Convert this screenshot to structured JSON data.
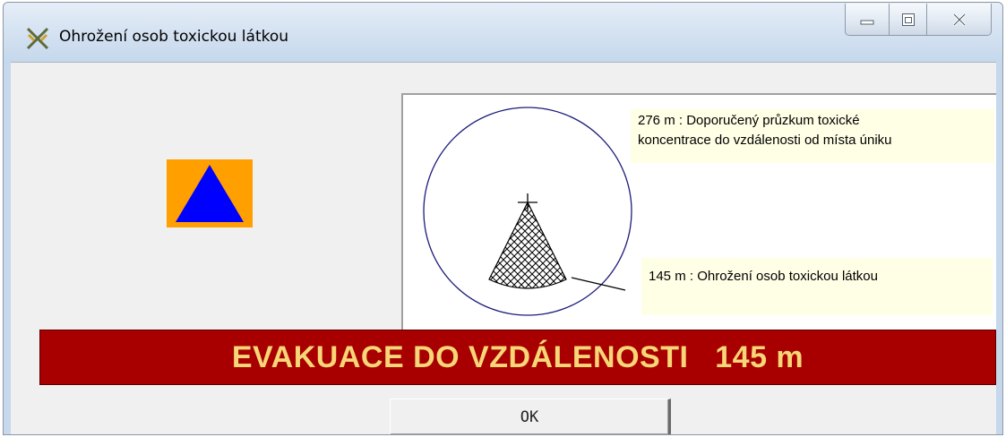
{
  "window": {
    "title": "Ohrožení osob toxickou látkou",
    "icon": "crossed-swords-icon",
    "controls": [
      "minimize-icon",
      "maximize-icon",
      "close-icon"
    ]
  },
  "sign": {
    "icon": "civil-protection-triangle-icon",
    "colors": {
      "background": "#ff9f00",
      "triangle": "#0000ff"
    }
  },
  "diagram": {
    "outer_zone": {
      "distance": "276 m",
      "label_line1": "276 m : Doporučený průzkum toxické",
      "label_line2": "koncentrace do vzdálenosti od místa úniku"
    },
    "danger_zone": {
      "distance": "145 m",
      "label": "145 m : Ohrožení osob toxickou látkou"
    },
    "colors": {
      "circle": "#1c1c7a",
      "note_background": "#ffffe6"
    }
  },
  "banner": {
    "text": "EVAKUACE DO VZDÁLENOSTI   145 m",
    "colors": {
      "background": "#a80000",
      "text": "#f7d677"
    }
  },
  "buttons": {
    "ok_label": "OK"
  }
}
